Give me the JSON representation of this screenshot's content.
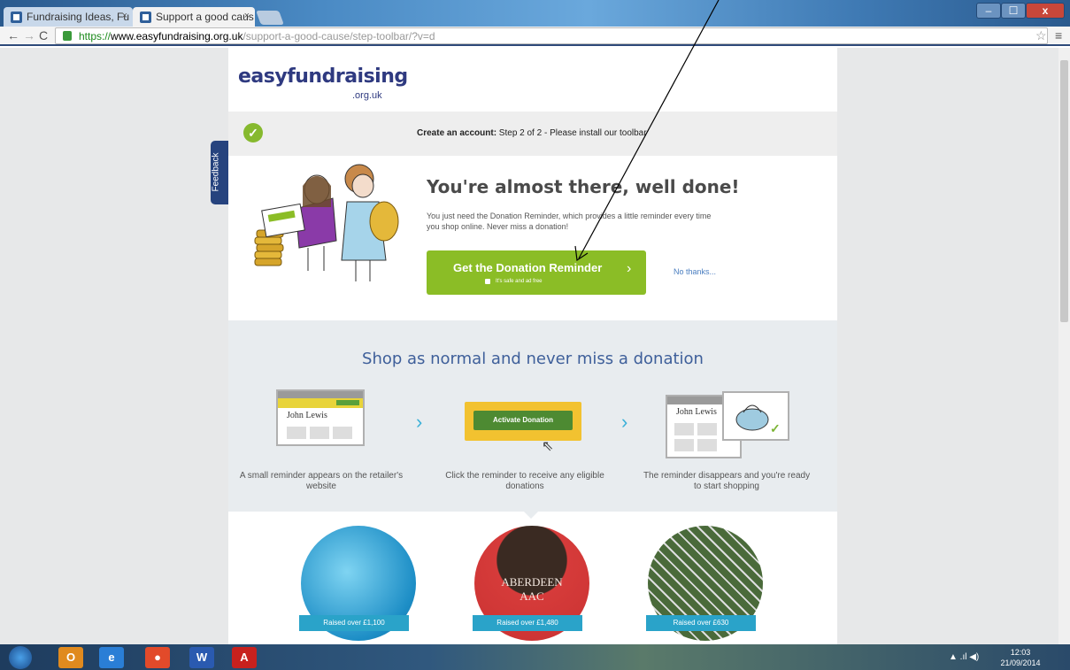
{
  "browser": {
    "tabs": [
      {
        "label": "Fundraising Ideas, Fu",
        "close": "×"
      },
      {
        "label": "Support a good caus",
        "close": "×"
      }
    ],
    "url_scheme": "https://",
    "url_host": "www.easyfundraising.org.uk",
    "url_path": "/support-a-good-cause/step-toolbar/?v=d",
    "window_controls": {
      "minimize": "–",
      "maximize": "☐",
      "close": "x"
    }
  },
  "page": {
    "logo": "easyfundraising",
    "logo_sub": ".org.uk",
    "step": {
      "bold": "Create an account:",
      "rest": " Step 2 of 2 - Please install our toolbar"
    },
    "feedback": "Feedback",
    "hero_title": "You're almost there, well done!",
    "hero_desc": "You just need the Donation Reminder, which provides a little reminder every time you shop online. Never miss a donation!",
    "cta_label": "Get the Donation Reminder",
    "cta_sub": "It's safe and ad free",
    "no_thanks": "No thanks...",
    "shop_title": "Shop as normal and never miss a donation",
    "steps": [
      {
        "caption": "A small reminder appears on the retailer's website",
        "card_text": "John Lewis"
      },
      {
        "caption": "Click the reminder to receive any eligible donations",
        "card_text": "Activate Donation"
      },
      {
        "caption": "The reminder disappears and you're ready to start shopping",
        "card_text": "John Lewis"
      }
    ],
    "circles": [
      {
        "raised": "Raised over £1,100"
      },
      {
        "raised": "Raised over £1,480",
        "shirt_text": "ABERDEEN AAC"
      },
      {
        "raised": "Raised over £630"
      }
    ]
  },
  "taskbar": {
    "time": "12:03",
    "date": "21/09/2014",
    "apps": [
      "Outlook",
      "Internet Explorer",
      "Chrome",
      "Word",
      "Acrobat"
    ]
  },
  "colors": {
    "brand_navy": "#2f3a80",
    "cta_green": "#8bbd26",
    "accent_blue": "#2aa3c9"
  }
}
